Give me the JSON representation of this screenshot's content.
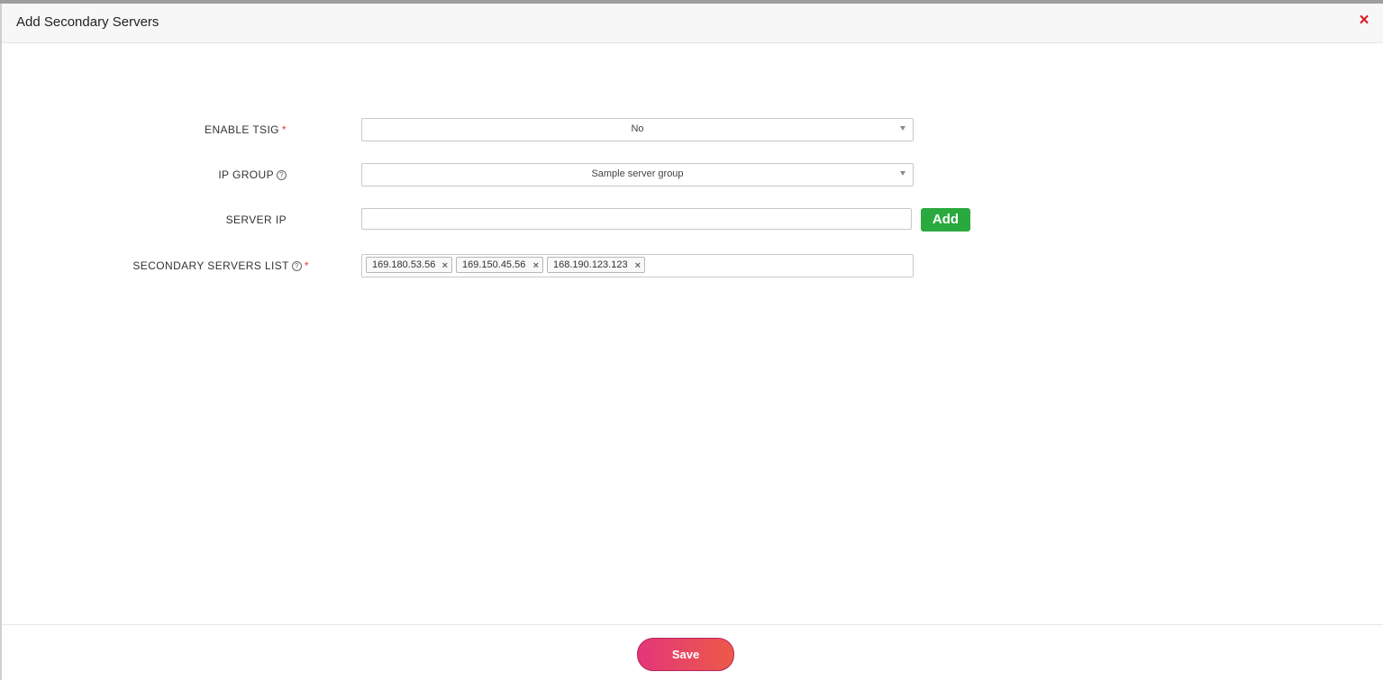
{
  "modal": {
    "title": "Add Secondary Servers",
    "close_icon": "close-icon",
    "close_glyph": "×"
  },
  "form": {
    "enable_tsig": {
      "label": "ENABLE TSIG",
      "required_mark": "*",
      "value": "No"
    },
    "ip_group": {
      "label": "IP GROUP",
      "help_icon": "help-icon",
      "help_glyph": "?",
      "value": "Sample server group"
    },
    "server_ip": {
      "label": "SERVER IP",
      "value": "",
      "add_label": "Add"
    },
    "secondary_servers_list": {
      "label": "SECONDARY SERVERS LIST",
      "help_icon": "help-icon",
      "help_glyph": "?",
      "required_mark": "*",
      "tags": [
        {
          "ip": "169.180.53.56",
          "remove": "×"
        },
        {
          "ip": "169.150.45.56",
          "remove": "×"
        },
        {
          "ip": "168.190.123.123",
          "remove": "×"
        }
      ]
    }
  },
  "footer": {
    "save_label": "Save"
  },
  "colors": {
    "close": "#e0161f",
    "add_button": "#2aa93f",
    "save_gradient_start": "#e3367a",
    "save_gradient_end": "#ec5a48",
    "required": "#e53935"
  }
}
